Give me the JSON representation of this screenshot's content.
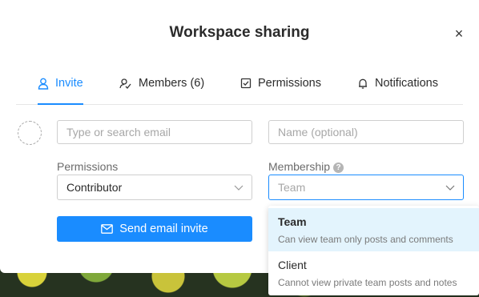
{
  "dialog": {
    "title": "Workspace sharing",
    "close_symbol": "×"
  },
  "tabs": [
    {
      "label": "Invite",
      "icon": "person-icon",
      "active": true
    },
    {
      "label": "Members (6)",
      "icon": "members-icon",
      "active": false
    },
    {
      "label": "Permissions",
      "icon": "checkbox-icon",
      "active": false
    },
    {
      "label": "Notifications",
      "icon": "bell-icon",
      "active": false
    }
  ],
  "invite_form": {
    "email_placeholder": "Type or search email",
    "name_placeholder": "Name (optional)",
    "permissions_label": "Permissions",
    "permissions_value": "Contributor",
    "membership_label": "Membership",
    "membership_help": "?",
    "membership_placeholder": "Team",
    "send_button": "Send email invite"
  },
  "membership_options": [
    {
      "title": "Team",
      "description": "Can view team only posts and comments",
      "highlighted": true
    },
    {
      "title": "Client",
      "description": "Cannot view private team posts and notes",
      "highlighted": false
    }
  ],
  "colors": {
    "accent": "#1a8cff",
    "highlight": "#e3f4fd"
  }
}
